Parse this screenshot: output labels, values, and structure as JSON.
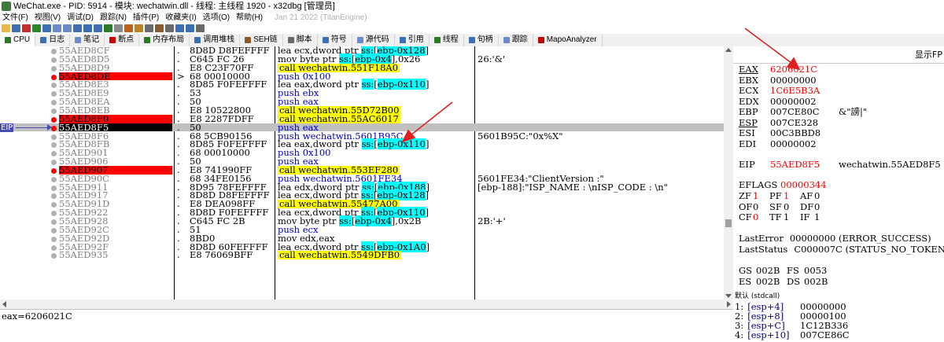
{
  "window": {
    "title": "WeChat.exe - PID: 5914 - 模块: wechatwin.dll - 线程: 主线程 1920 - x32dbg [管理员]"
  },
  "menu": {
    "items": [
      "文件(F)",
      "视图(V)",
      "调试(D)",
      "跟踪(N)",
      "插件(P)",
      "收藏夹(I)",
      "选项(O)",
      "帮助(H)"
    ],
    "build": "Jan 21 2022 (TitanEngine)"
  },
  "tabs": [
    {
      "label": "CPU",
      "icon": "cpu-icon",
      "color": "#2a7a2a"
    },
    {
      "label": "日志",
      "icon": "log-icon",
      "color": "#3c6fb4"
    },
    {
      "label": "笔记",
      "icon": "notes-icon",
      "color": "#6a8ac8"
    },
    {
      "label": "断点",
      "icon": "breakpoint-icon",
      "color": "#d00000"
    },
    {
      "label": "内存布局",
      "icon": "memory-map-icon",
      "color": "#2a7a2a"
    },
    {
      "label": "调用堆栈",
      "icon": "call-stack-icon",
      "color": "#3c6fb4"
    },
    {
      "label": "SEH链",
      "icon": "seh-icon",
      "color": "#8a5a2a"
    },
    {
      "label": "脚本",
      "icon": "script-icon",
      "color": "#6a6a6a"
    },
    {
      "label": "符号",
      "icon": "symbols-icon",
      "color": "#3c6fb4"
    },
    {
      "label": "源代码",
      "icon": "source-icon",
      "color": "#6a8ac8"
    },
    {
      "label": "引用",
      "icon": "references-icon",
      "color": "#3c6fb4"
    },
    {
      "label": "线程",
      "icon": "threads-icon",
      "color": "#2a7a2a"
    },
    {
      "label": "句柄",
      "icon": "handles-icon",
      "color": "#3c6fb4"
    },
    {
      "label": "跟踪",
      "icon": "trace-icon",
      "color": "#6a8ac8"
    },
    {
      "label": "MapoAnalyzer",
      "icon": "mapo-icon",
      "color": "#c00000"
    }
  ],
  "disasm": {
    "eip_label": "EIP",
    "rows": [
      {
        "addr": "55AED8CF",
        "dot": "grey",
        "bp": false,
        "arrow": ".",
        "bytes": "8D8D D8FEFFFF",
        "ins": [
          {
            "t": "lea ecx,dword ptr "
          },
          {
            "t": "ss:",
            "hl": true
          },
          {
            "t": "["
          },
          {
            "t": "ebp-0x128",
            "hl": true
          },
          {
            "t": "]"
          }
        ],
        "type": "normal",
        "cmt": ""
      },
      {
        "addr": "55AED8D5",
        "dot": "grey",
        "bp": false,
        "arrow": ".",
        "bytes": "C645 FC 26",
        "ins": [
          {
            "t": "mov byte ptr "
          },
          {
            "t": "ss:",
            "hl": true
          },
          {
            "t": "["
          },
          {
            "t": "ebp-0x4",
            "hl": true
          },
          {
            "t": "],0x26"
          }
        ],
        "type": "normal",
        "cmt": "26:'&'"
      },
      {
        "addr": "55AED8D9",
        "dot": "grey",
        "bp": false,
        "arrow": ".",
        "bytes": "E8 C23F70FF",
        "ins": [
          {
            "t": "call wechatwin.551F18A0"
          }
        ],
        "type": "call",
        "cmt": ""
      },
      {
        "addr": "55AED8DE",
        "dot": "red",
        "bp": true,
        "arrow": ">",
        "bytes": "68 00010000",
        "ins": [
          {
            "t": "push 0x100"
          }
        ],
        "type": "push",
        "cmt": ""
      },
      {
        "addr": "55AED8E3",
        "dot": "grey",
        "bp": false,
        "arrow": ".",
        "bytes": "8D85 F0FEFFFF",
        "ins": [
          {
            "t": "lea eax,dword ptr "
          },
          {
            "t": "ss:",
            "hl": true
          },
          {
            "t": "["
          },
          {
            "t": "ebp-0x110",
            "hl": true
          },
          {
            "t": "]"
          }
        ],
        "type": "normal",
        "cmt": ""
      },
      {
        "addr": "55AED8E9",
        "dot": "grey",
        "bp": false,
        "arrow": ".",
        "bytes": "53",
        "ins": [
          {
            "t": "push ebx"
          }
        ],
        "type": "push",
        "cmt": ""
      },
      {
        "addr": "55AED8EA",
        "dot": "grey",
        "bp": false,
        "arrow": ".",
        "bytes": "50",
        "ins": [
          {
            "t": "push eax"
          }
        ],
        "type": "push",
        "cmt": ""
      },
      {
        "addr": "55AED8EB",
        "dot": "grey",
        "bp": false,
        "arrow": ".",
        "bytes": "E8 10522800",
        "ins": [
          {
            "t": "call wechatwin.55D72B00"
          }
        ],
        "type": "call",
        "cmt": ""
      },
      {
        "addr": "55AED8F0",
        "dot": "red",
        "bp": true,
        "arrow": ".",
        "bytes": "E8 2287FDFF",
        "ins": [
          {
            "t": "call wechatwin.55AC6017"
          }
        ],
        "type": "call",
        "cmt": ""
      },
      {
        "addr": "55AED8F5",
        "dot": "red",
        "bp": false,
        "eip": true,
        "arrow": ".",
        "bytes": "50",
        "ins": [
          {
            "t": "push eax"
          }
        ],
        "type": "push",
        "cmt": ""
      },
      {
        "addr": "55AED8F6",
        "dot": "grey",
        "bp": false,
        "arrow": ".",
        "bytes": "68 5CB90156",
        "ins": [
          {
            "t": "push wechatwin.5601B95C"
          }
        ],
        "type": "push",
        "cmt": "5601B95C:\"0x%X\""
      },
      {
        "addr": "55AED8FB",
        "dot": "grey",
        "bp": false,
        "arrow": ".",
        "bytes": "8D85 F0FEFFFF",
        "ins": [
          {
            "t": "lea eax,dword ptr "
          },
          {
            "t": "ss:",
            "hl": true
          },
          {
            "t": "["
          },
          {
            "t": "ebp-0x110",
            "hl": true
          },
          {
            "t": "]"
          }
        ],
        "type": "normal",
        "cmt": ""
      },
      {
        "addr": "55AED901",
        "dot": "grey",
        "bp": false,
        "arrow": ".",
        "bytes": "68 00010000",
        "ins": [
          {
            "t": "push 0x100"
          }
        ],
        "type": "push",
        "cmt": ""
      },
      {
        "addr": "55AED906",
        "dot": "grey",
        "bp": false,
        "arrow": ".",
        "bytes": "50",
        "ins": [
          {
            "t": "push eax"
          }
        ],
        "type": "push",
        "cmt": ""
      },
      {
        "addr": "55AED907",
        "dot": "red",
        "bp": true,
        "arrow": ".",
        "bytes": "E8 741990FF",
        "ins": [
          {
            "t": "call wechatwin.553EF280"
          }
        ],
        "type": "call",
        "cmt": ""
      },
      {
        "addr": "55AED90C",
        "dot": "grey",
        "bp": false,
        "arrow": ".",
        "bytes": "68 34FE0156",
        "ins": [
          {
            "t": "push wechatwin.5601FE34"
          }
        ],
        "type": "push",
        "cmt": "5601FE34:\"ClientVersion :\""
      },
      {
        "addr": "55AED911",
        "dot": "grey",
        "bp": false,
        "arrow": ".",
        "bytes": "8D95 78FEFFFF",
        "ins": [
          {
            "t": "lea edx,dword ptr "
          },
          {
            "t": "ss:",
            "hl": true
          },
          {
            "t": "["
          },
          {
            "t": "ebp-0x188",
            "hl": true
          },
          {
            "t": "]"
          }
        ],
        "type": "normal",
        "cmt": "[ebp-188]:\"ISP_NAME : \\nISP_CODE : \\n\""
      },
      {
        "addr": "55AED917",
        "dot": "grey",
        "bp": false,
        "arrow": ".",
        "bytes": "8D8D D8FEFFFF",
        "ins": [
          {
            "t": "lea ecx,dword ptr "
          },
          {
            "t": "ss:",
            "hl": true
          },
          {
            "t": "["
          },
          {
            "t": "ebp-0x128",
            "hl": true
          },
          {
            "t": "]"
          }
        ],
        "type": "normal",
        "cmt": ""
      },
      {
        "addr": "55AED91D",
        "dot": "grey",
        "bp": false,
        "arrow": ".",
        "bytes": "E8 DEA098FF",
        "ins": [
          {
            "t": "call wechatwin.55477A00"
          }
        ],
        "type": "call",
        "cmt": ""
      },
      {
        "addr": "55AED922",
        "dot": "grey",
        "bp": false,
        "arrow": ".",
        "bytes": "8D8D F0FEFFFF",
        "ins": [
          {
            "t": "lea ecx,dword ptr "
          },
          {
            "t": "ss:",
            "hl": true
          },
          {
            "t": "["
          },
          {
            "t": "ebp-0x110",
            "hl": true
          },
          {
            "t": "]"
          }
        ],
        "type": "normal",
        "cmt": ""
      },
      {
        "addr": "55AED928",
        "dot": "grey",
        "bp": false,
        "arrow": ".",
        "bytes": "C645 FC 2B",
        "ins": [
          {
            "t": "mov byte ptr "
          },
          {
            "t": "ss:",
            "hl": true
          },
          {
            "t": "["
          },
          {
            "t": "ebp-0x4",
            "hl": true
          },
          {
            "t": "],0x2B"
          }
        ],
        "type": "normal",
        "cmt": "2B:'+'"
      },
      {
        "addr": "55AED92C",
        "dot": "grey",
        "bp": false,
        "arrow": ".",
        "bytes": "51",
        "ins": [
          {
            "t": "push ecx"
          }
        ],
        "type": "push",
        "cmt": ""
      },
      {
        "addr": "55AED92D",
        "dot": "grey",
        "bp": false,
        "arrow": ".",
        "bytes": "8BD0",
        "ins": [
          {
            "t": "mov edx,eax"
          }
        ],
        "type": "normal",
        "cmt": ""
      },
      {
        "addr": "55AED92F",
        "dot": "grey",
        "bp": false,
        "arrow": ".",
        "bytes": "8D8D 60FEFFFF",
        "ins": [
          {
            "t": "lea ecx,dword ptr "
          },
          {
            "t": "ss:",
            "hl": true
          },
          {
            "t": "["
          },
          {
            "t": "ebp-0x1A0",
            "hl": true
          },
          {
            "t": "]"
          }
        ],
        "type": "normal",
        "cmt": ""
      },
      {
        "addr": "55AED935",
        "dot": "grey",
        "bp": false,
        "arrow": ".",
        "bytes": "E8 76069BFF",
        "ins": [
          {
            "t": "call wechatwin.5549DFB0"
          }
        ],
        "type": "call",
        "cmt": ""
      }
    ]
  },
  "registers": {
    "header": "显示FP",
    "gp": [
      {
        "name": "EAX",
        "value": "6206021C",
        "red": true,
        "underline": true,
        "extra": ""
      },
      {
        "name": "EBX",
        "value": "00000000",
        "red": false,
        "underline": false,
        "extra": ""
      },
      {
        "name": "ECX",
        "value": "1C6E5B3A",
        "red": true,
        "underline": false,
        "extra": ""
      },
      {
        "name": "EDX",
        "value": "00000002",
        "red": false,
        "underline": false,
        "extra": ""
      },
      {
        "name": "EBP",
        "value": "007CE80C",
        "red": false,
        "underline": false,
        "extra": "&\"謗|\""
      },
      {
        "name": "ESP",
        "value": "007CE328",
        "red": false,
        "underline": true,
        "extra": ""
      },
      {
        "name": "ESI",
        "value": "00C3BBD8",
        "red": false,
        "underline": false,
        "extra": ""
      },
      {
        "name": "EDI",
        "value": "00000002",
        "red": false,
        "underline": false,
        "extra": ""
      }
    ],
    "eip": {
      "name": "EIP",
      "value": "55AED8F5",
      "extra": "wechatwin.55AED8F5"
    },
    "eflags": {
      "name": "EFLAGS",
      "value": "00000344"
    },
    "flags": [
      [
        {
          "n": "ZF",
          "v": "1",
          "red": true
        },
        {
          "n": "PF",
          "v": "1",
          "red": true
        },
        {
          "n": "AF",
          "v": "0",
          "red": false
        }
      ],
      [
        {
          "n": "OF",
          "v": "0",
          "red": false
        },
        {
          "n": "SF",
          "v": "0",
          "red": false
        },
        {
          "n": "DF",
          "v": "0",
          "red": false
        }
      ],
      [
        {
          "n": "CF",
          "v": "0",
          "red": true
        },
        {
          "n": "TF",
          "v": "1",
          "red": false
        },
        {
          "n": "IF",
          "v": "1",
          "red": false
        }
      ]
    ],
    "last_error": {
      "name": "LastError",
      "value": "00000000 (ERROR_SUCCESS)"
    },
    "last_status": {
      "name": "LastStatus",
      "value": "C000007C (STATUS_NO_TOKEN)"
    },
    "segs": [
      {
        "a": "GS",
        "av": "002B",
        "b": "FS",
        "bv": "0053"
      },
      {
        "a": "ES",
        "av": "002B",
        "b": "DS",
        "bv": "002B"
      }
    ]
  },
  "status": {
    "text": "eax=6206021C"
  },
  "stack": {
    "header": "默认 (stdcall)",
    "items": [
      {
        "idx": "1:",
        "expr": "[esp+4]",
        "value": "00000000"
      },
      {
        "idx": "2:",
        "expr": "[esp+8]",
        "value": "00000100"
      },
      {
        "idx": "3:",
        "expr": "[esp+C]",
        "value": "1C12B336"
      },
      {
        "idx": "4:",
        "expr": "[esp+10]",
        "value": "007CE86C"
      }
    ]
  },
  "colors": {
    "breakpoint": "#ff0000",
    "call_highlight": "#ffff00",
    "operand_highlight": "#00ffff",
    "eip_marker": "#4a4ab5",
    "current_row": "#c0c0c0"
  }
}
